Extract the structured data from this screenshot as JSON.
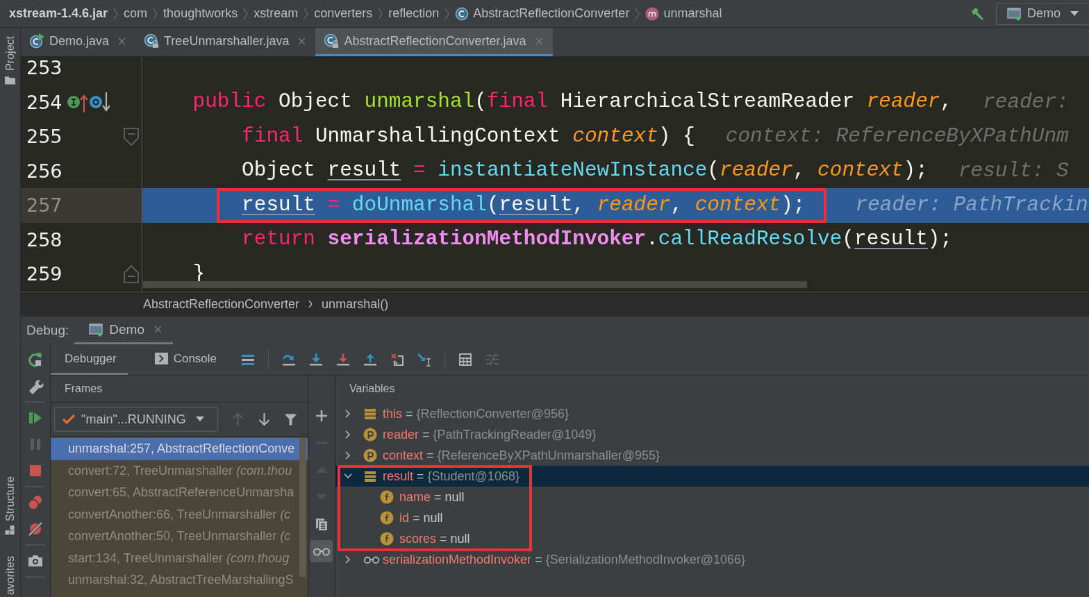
{
  "nav_bar": {
    "crumbs": [
      {
        "label": "xstream-1.4.6.jar",
        "kind": "jar"
      },
      {
        "label": "com",
        "kind": "package"
      },
      {
        "label": "thoughtworks",
        "kind": "package"
      },
      {
        "label": "xstream",
        "kind": "package"
      },
      {
        "label": "converters",
        "kind": "package"
      },
      {
        "label": "reflection",
        "kind": "package"
      },
      {
        "label": "AbstractReflectionConverter",
        "kind": "class"
      },
      {
        "label": "unmarshal",
        "kind": "method"
      }
    ],
    "run_config": "Demo"
  },
  "tool_strip": {
    "top": [
      "Project"
    ],
    "bottom": [
      "Structure",
      "avorites"
    ]
  },
  "editor_tabs": [
    {
      "label": "Demo.java",
      "kind": "runnable",
      "selected": false
    },
    {
      "label": "TreeUnmarshaller.java",
      "kind": "locked",
      "selected": false
    },
    {
      "label": "AbstractReflectionConverter.java",
      "kind": "locked",
      "selected": true
    }
  ],
  "code_lines": [
    {
      "number": "253",
      "current": false
    },
    {
      "number": "254",
      "current": false,
      "boxed": false,
      "markers": [
        {
          "kind": "implements"
        },
        {
          "kind": "overridden"
        }
      ],
      "tokens": [
        {
          "kind": "kw",
          "text": "    public "
        },
        {
          "kind": "plain",
          "text": "Object "
        },
        {
          "kind": "decl",
          "text": "unmarshal"
        },
        {
          "kind": "plain",
          "text": "("
        },
        {
          "kind": "kw",
          "text": "final "
        },
        {
          "kind": "plain",
          "text": "HierarchicalStreamReader "
        },
        {
          "kind": "param",
          "text": "reader"
        },
        {
          "kind": "plain",
          "text": ","
        }
      ],
      "hint": "reader:"
    },
    {
      "number": "255",
      "current": false,
      "boxed": false,
      "fold": {
        "kind": "start"
      },
      "tokens": [
        {
          "kind": "kw",
          "text": "        final "
        },
        {
          "kind": "plain",
          "text": "UnmarshallingContext "
        },
        {
          "kind": "param",
          "text": "context"
        },
        {
          "kind": "plain",
          "text": ") {"
        }
      ],
      "hint": "context: ReferenceByXPathUnm"
    },
    {
      "number": "256",
      "current": false,
      "boxed": false,
      "tokens": [
        {
          "kind": "plain",
          "text": "        Object "
        },
        {
          "kind": "local",
          "text": "result"
        },
        {
          "kind": "op",
          "text": " = "
        },
        {
          "kind": "call",
          "text": "instantiateNewInstance"
        },
        {
          "kind": "plain",
          "text": "("
        },
        {
          "kind": "param",
          "text": "reader"
        },
        {
          "kind": "plain",
          "text": ", "
        },
        {
          "kind": "param",
          "text": "context"
        },
        {
          "kind": "plain",
          "text": ");"
        }
      ],
      "hint": "result: S"
    },
    {
      "number": "257",
      "current": true,
      "boxed": true,
      "tokens": [
        {
          "kind": "local",
          "text": "        result"
        },
        {
          "kind": "op",
          "text": " = "
        },
        {
          "kind": "call",
          "text": "doUnmarshal"
        },
        {
          "kind": "plain",
          "text": "("
        },
        {
          "kind": "local",
          "text": "result"
        },
        {
          "kind": "plain",
          "text": ", "
        },
        {
          "kind": "param",
          "text": "reader"
        },
        {
          "kind": "plain",
          "text": ", "
        },
        {
          "kind": "param",
          "text": "context"
        },
        {
          "kind": "plain",
          "text": ");"
        }
      ],
      "hint": "reader: PathTrackin"
    },
    {
      "number": "258",
      "current": false,
      "boxed": false,
      "tokens": [
        {
          "kind": "kw",
          "text": "        return "
        },
        {
          "kind": "field",
          "text": "serializationMethodInvoker"
        },
        {
          "kind": "plain",
          "text": "."
        },
        {
          "kind": "call",
          "text": "callReadResolve"
        },
        {
          "kind": "plain",
          "text": "("
        },
        {
          "kind": "local",
          "text": "result"
        },
        {
          "kind": "plain",
          "text": ");"
        }
      ]
    },
    {
      "number": "259",
      "current": false,
      "boxed": false,
      "fold": {
        "kind": "end"
      },
      "tokens": [
        {
          "kind": "plain",
          "text": "    }"
        }
      ]
    }
  ],
  "code_breadcrumbs": [
    "AbstractReflectionConverter",
    "unmarshal()"
  ],
  "debug": {
    "label": "Debug:",
    "session": "Demo",
    "tabs": [
      {
        "label": "Debugger",
        "kind": "debugger",
        "selected": true
      },
      {
        "label": "Console",
        "kind": "console",
        "selected": false
      }
    ]
  },
  "frames": {
    "title": "Frames",
    "thread": "\"main\"...RUNNING",
    "items": [
      {
        "text": "unmarshal:257, AbstractReflectionConve",
        "selected": true
      },
      {
        "text": "convert:72, TreeUnmarshaller *(com.thou*",
        "selected": false
      },
      {
        "text": "convert:65, AbstractReferenceUnmarsha",
        "selected": false
      },
      {
        "text": "convertAnother:66, TreeUnmarshaller *(c*",
        "selected": false
      },
      {
        "text": "convertAnother:50, TreeUnmarshaller *(c*",
        "selected": false
      },
      {
        "text": "start:134, TreeUnmarshaller *(com.thoug*",
        "selected": false
      },
      {
        "text": "unmarshal:32, AbstractTreeMarshallingS",
        "selected": false
      }
    ]
  },
  "variables": {
    "title": "Variables",
    "items": [
      {
        "name": "this",
        "operator": "=",
        "value": "{ReflectionConverter@956}",
        "kind": "object",
        "expanded": false,
        "selected": false
      },
      {
        "name": "reader",
        "operator": "=",
        "value": "{PathTrackingReader@1049}",
        "kind": "parameter",
        "expanded": false,
        "selected": false
      },
      {
        "name": "context",
        "operator": "=",
        "value": "{ReferenceByXPathUnmarshaller@955}",
        "kind": "parameter",
        "expanded": false,
        "selected": false
      },
      {
        "name": "result",
        "operator": "=",
        "value": "{Student@1068}",
        "kind": "object",
        "expanded": true,
        "selected": true,
        "boxed": true,
        "children": [
          {
            "name": "name",
            "operator": "=",
            "value": "null",
            "kind": "field",
            "selected": false
          },
          {
            "name": "id",
            "operator": "=",
            "value": "null",
            "kind": "field",
            "selected": false
          },
          {
            "name": "scores",
            "operator": "=",
            "value": "null",
            "kind": "field",
            "selected": false
          }
        ]
      },
      {
        "name": "serializationMethodInvoker",
        "operator": "=",
        "value": "{SerializationMethodInvoker@1066}",
        "kind": "watch",
        "expanded": false,
        "selected": false
      }
    ]
  }
}
